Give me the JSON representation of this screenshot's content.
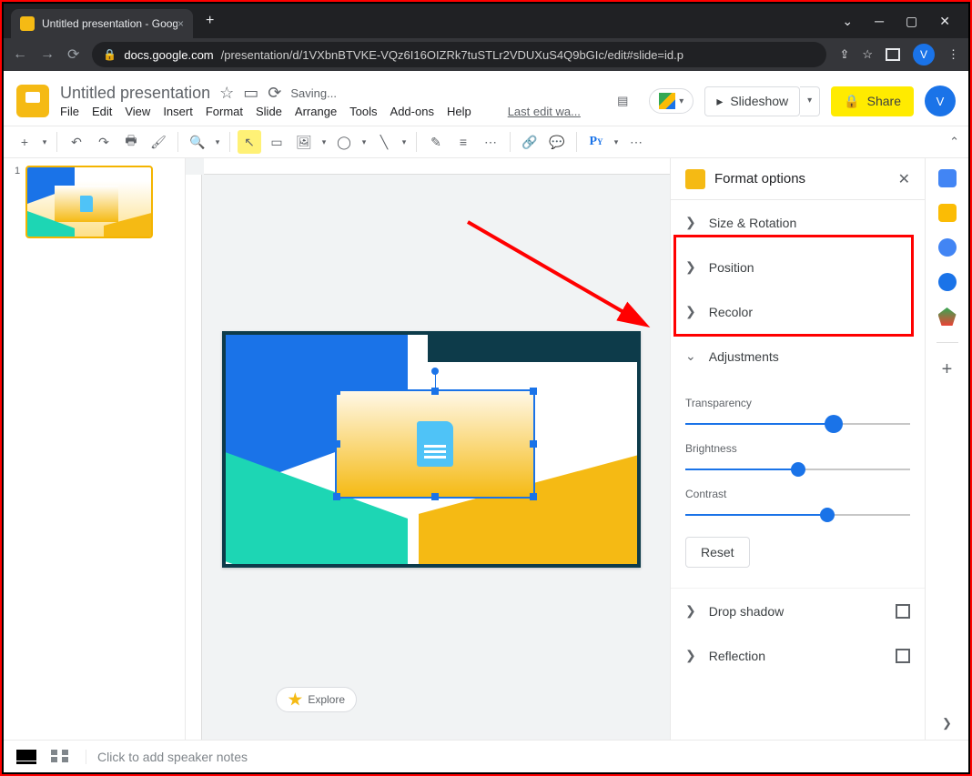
{
  "browser": {
    "tab_title": "Untitled presentation - Google Sl",
    "url_domain": "docs.google.com",
    "url_path": "/presentation/d/1VXbnBTVKE-VQz6I16OIZRk7tuSTLr2VDUXuS4Q9bGIc/edit#slide=id.p",
    "avatar_letter": "V"
  },
  "header": {
    "doc_title": "Untitled presentation",
    "saving": "Saving...",
    "last_edit": "Last edit wa...",
    "menus": [
      "File",
      "Edit",
      "View",
      "Insert",
      "Format",
      "Slide",
      "Arrange",
      "Tools",
      "Add-ons",
      "Help"
    ],
    "slideshow": "Slideshow",
    "share": "Share"
  },
  "filmstrip": {
    "slide_number": "1"
  },
  "sidebar": {
    "title": "Format options",
    "items": {
      "size_rotation": "Size & Rotation",
      "position": "Position",
      "recolor": "Recolor",
      "adjustments": "Adjustments",
      "drop_shadow": "Drop shadow",
      "reflection": "Reflection"
    },
    "adjustments": {
      "transparency_label": "Transparency",
      "brightness_label": "Brightness",
      "contrast_label": "Contrast",
      "transparency_pct": 65,
      "brightness_pct": 50,
      "contrast_pct": 63,
      "reset": "Reset"
    }
  },
  "speaker_notes_placeholder": "Click to add speaker notes",
  "explore": "Explore"
}
